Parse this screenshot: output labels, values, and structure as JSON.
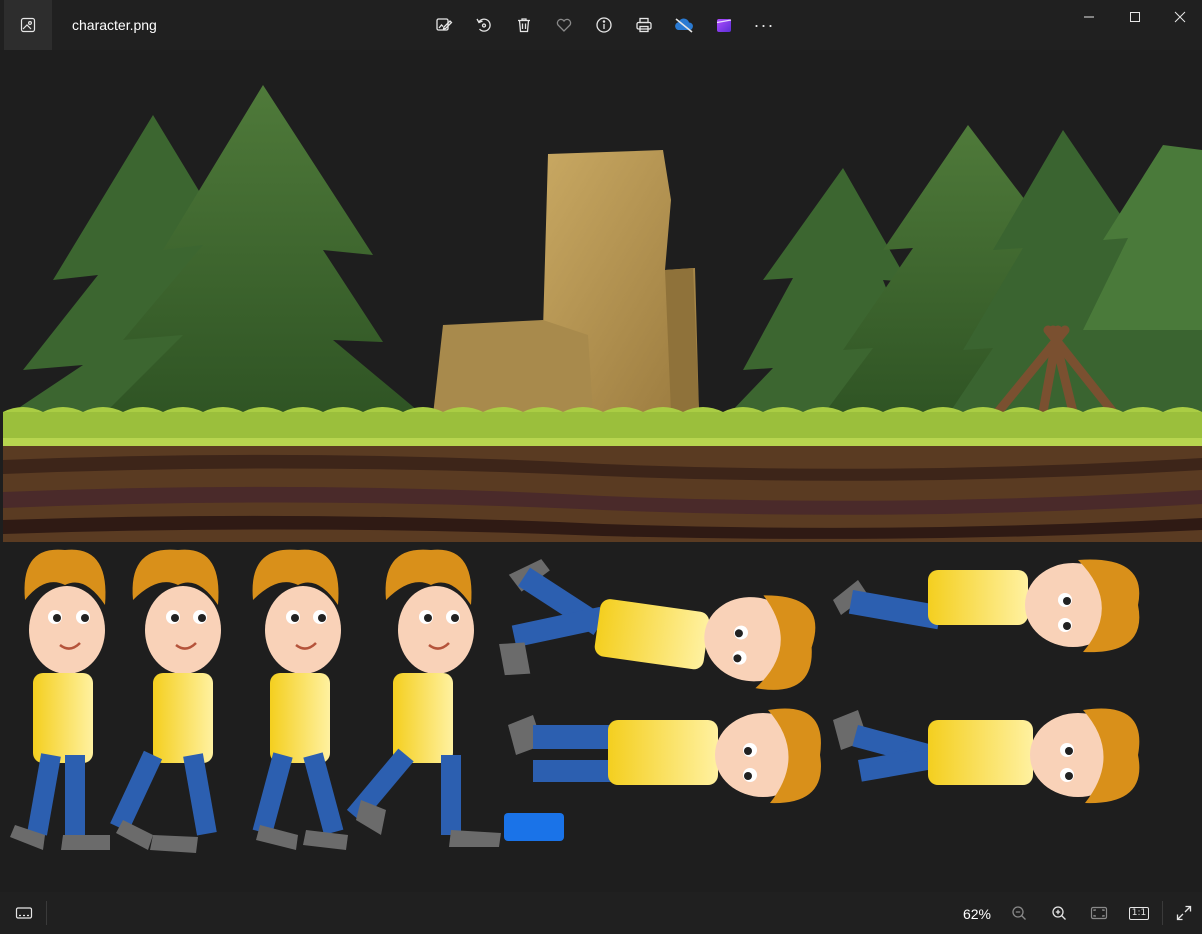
{
  "window": {
    "file_name": "character.png"
  },
  "toolbar": {
    "items": [
      {
        "name": "edit-image",
        "icon": "edit-icon"
      },
      {
        "name": "rotate",
        "icon": "rotate-icon"
      },
      {
        "name": "delete",
        "icon": "trash-icon"
      },
      {
        "name": "favorite",
        "icon": "heart-icon"
      },
      {
        "name": "file-info",
        "icon": "info-icon"
      },
      {
        "name": "print",
        "icon": "print-icon"
      },
      {
        "name": "onedrive",
        "icon": "cloud-icon"
      },
      {
        "name": "clipchamp",
        "icon": "clipchamp-icon"
      },
      {
        "name": "more",
        "icon": "more-icon"
      }
    ],
    "more_label": "···"
  },
  "window_controls": [
    "minimize",
    "maximize",
    "close"
  ],
  "status": {
    "zoom_level": "62%",
    "actual_size_label": "1:1"
  },
  "colors": {
    "background": "#1e1e1e",
    "titlebar": "#202020",
    "accent": "#1a73e8",
    "grass": "#9bbf3c",
    "soil": "#5a3b22",
    "tree": "#3f6b2f",
    "shirt": "#f5d420",
    "pants": "#2c5fb0",
    "hair": "#d9901a"
  }
}
